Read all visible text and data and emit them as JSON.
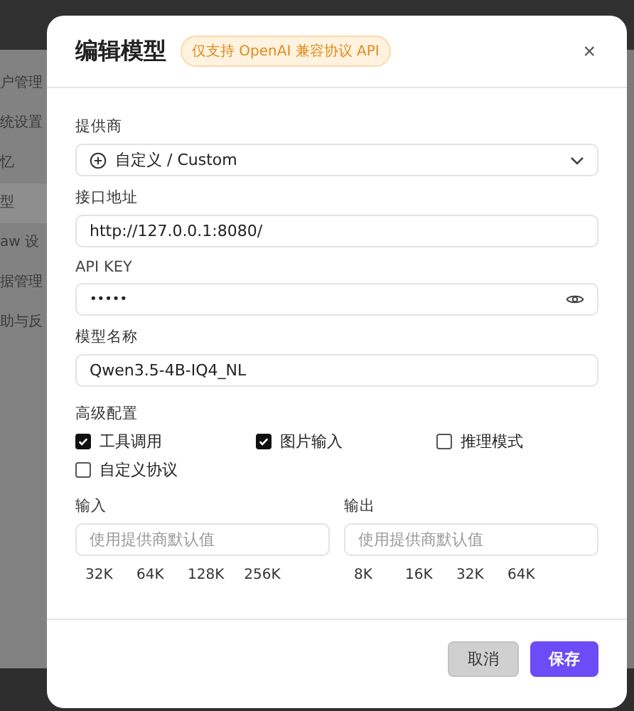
{
  "sidebar": {
    "items": [
      {
        "label": "户管理",
        "selected": false
      },
      {
        "label": "统设置",
        "selected": false
      },
      {
        "label": "忆",
        "selected": false
      },
      {
        "label": "型",
        "selected": true
      },
      {
        "label": "aw 设",
        "selected": false
      },
      {
        "label": "据管理",
        "selected": false
      },
      {
        "label": "助与反",
        "selected": false
      }
    ]
  },
  "dialog": {
    "title": "编辑模型",
    "badge": "仅支持 OpenAI 兼容协议 API",
    "close": "×",
    "provider": {
      "label": "提供商",
      "value": "自定义 / Custom"
    },
    "endpoint": {
      "label": "接口地址",
      "value": "http://127.0.0.1:8080/"
    },
    "api_key": {
      "label": "API KEY",
      "value": "•••••"
    },
    "model_name": {
      "label": "模型名称",
      "value": "Qwen3.5-4B-IQ4_NL"
    },
    "advanced": {
      "label": "高级配置",
      "options": [
        {
          "label": "工具调用",
          "checked": true
        },
        {
          "label": "图片输入",
          "checked": true
        },
        {
          "label": "推理模式",
          "checked": false
        },
        {
          "label": "自定义协议",
          "checked": false
        }
      ]
    },
    "input": {
      "label": "输入",
      "placeholder": "使用提供商默认值",
      "presets": [
        "32K",
        "64K",
        "128K",
        "256K"
      ]
    },
    "output": {
      "label": "输出",
      "placeholder": "使用提供商默认值",
      "presets": [
        "8K",
        "16K",
        "32K",
        "64K"
      ]
    },
    "buttons": [
      {
        "label": "取消",
        "kind": "secondary"
      },
      {
        "label": "保存",
        "kind": "primary"
      }
    ]
  }
}
